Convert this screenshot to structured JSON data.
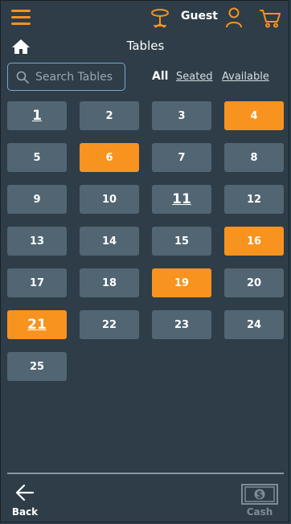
{
  "header": {
    "guest_label": "Guest"
  },
  "page_title": "Tables",
  "search": {
    "placeholder": "Search Tables",
    "value": ""
  },
  "filters": [
    {
      "label": "All",
      "active": true
    },
    {
      "label": "Seated",
      "active": false
    },
    {
      "label": "Available",
      "active": false
    }
  ],
  "tables": [
    {
      "label": "1",
      "status": "available",
      "style": "large"
    },
    {
      "label": "2",
      "status": "available"
    },
    {
      "label": "3",
      "status": "available"
    },
    {
      "label": "4",
      "status": "seated"
    },
    {
      "label": "5",
      "status": "available"
    },
    {
      "label": "6",
      "status": "seated"
    },
    {
      "label": "7",
      "status": "available"
    },
    {
      "label": "8",
      "status": "available"
    },
    {
      "label": "9",
      "status": "available"
    },
    {
      "label": "10",
      "status": "available"
    },
    {
      "label": "11",
      "status": "available",
      "style": "large"
    },
    {
      "label": "12",
      "status": "available"
    },
    {
      "label": "13",
      "status": "available"
    },
    {
      "label": "14",
      "status": "available"
    },
    {
      "label": "15",
      "status": "available"
    },
    {
      "label": "16",
      "status": "seated"
    },
    {
      "label": "17",
      "status": "available"
    },
    {
      "label": "18",
      "status": "available"
    },
    {
      "label": "19",
      "status": "seated"
    },
    {
      "label": "20",
      "status": "available"
    },
    {
      "label": "21",
      "status": "seated",
      "style": "large"
    },
    {
      "label": "22",
      "status": "available"
    },
    {
      "label": "23",
      "status": "available"
    },
    {
      "label": "24",
      "status": "available"
    },
    {
      "label": "25",
      "status": "available"
    }
  ],
  "footer": {
    "back_label": "Back",
    "cash_label": "Cash"
  },
  "colors": {
    "background": "#2e3d48",
    "accent": "#f7931e",
    "table_default": "#526573",
    "disabled": "#7f8c96"
  },
  "icons": {
    "menu": "hamburger-menu-icon",
    "table": "table-icon",
    "user": "user-icon",
    "cart": "shopping-cart-icon",
    "home": "home-icon",
    "search": "search-icon",
    "back": "arrow-left-icon",
    "cash": "dollar-bill-icon"
  }
}
